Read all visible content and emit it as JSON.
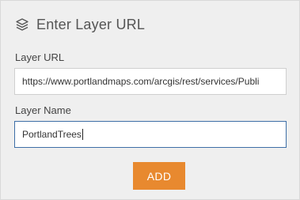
{
  "header": {
    "icon": "layers-icon",
    "title": "Enter Layer URL"
  },
  "fields": {
    "url": {
      "label": "Layer URL",
      "value": "https://www.portlandmaps.com/arcgis/rest/services/Publi"
    },
    "name": {
      "label": "Layer Name",
      "value": "PortlandTrees"
    }
  },
  "actions": {
    "add_label": "ADD",
    "add_color": "#e8892f"
  }
}
